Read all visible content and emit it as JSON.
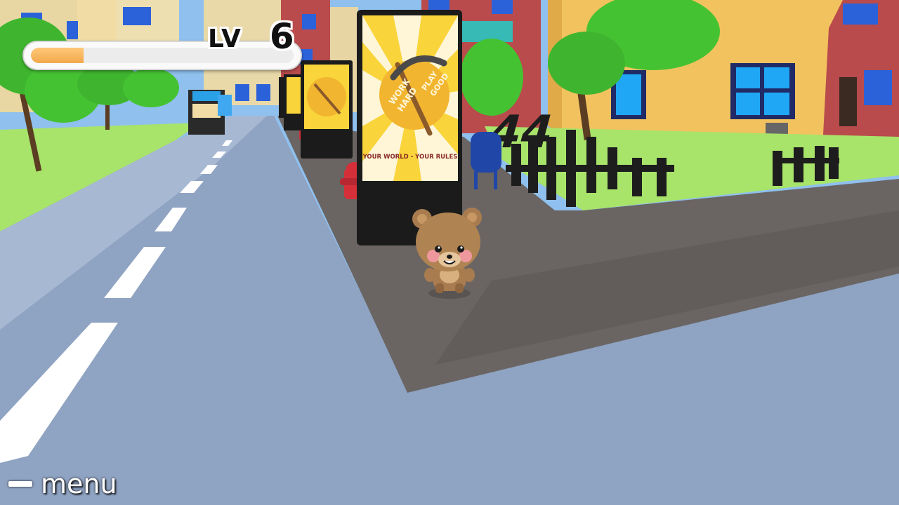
{
  "hud": {
    "level_label": "LV",
    "level_value": "6",
    "xp_fraction": 0.2
  },
  "controls": {
    "menu_label": "menu"
  },
  "billboard": {
    "line1": "WORK",
    "line2": "HARD",
    "line3": "PLAY",
    "line4": "GOOD",
    "tagline": "YOUR WORLD - YOUR RULES"
  },
  "scene": {
    "house_number": "44",
    "colors": {
      "sky": "#8fc0ee",
      "road": "#8fa3c2",
      "grass": "#a8e36a",
      "cobblestone": "#6a6563",
      "yellow_house": "#f2c25f",
      "red_building": "#b94b4d",
      "billboard_yellow": "#f9d43a",
      "bear_brown": "#a97c4f"
    }
  }
}
